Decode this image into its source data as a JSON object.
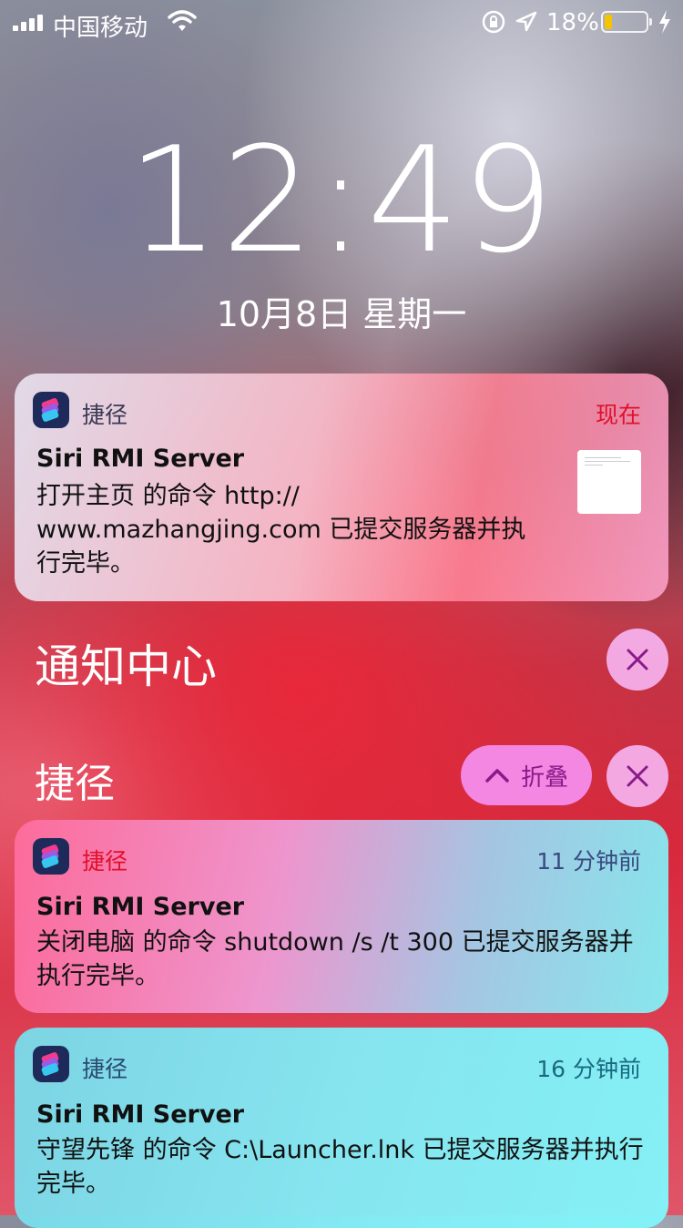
{
  "status_bar": {
    "carrier": "中国移动",
    "battery_percent_text": "18%",
    "battery_level": 0.18,
    "battery_color": "#f5c400"
  },
  "lock_screen": {
    "time": "12:49",
    "date": "10月8日 星期一"
  },
  "notifications": [
    {
      "app": "捷径",
      "time": "现在",
      "time_color": "#e0102a",
      "title": "Siri RMI Server",
      "body": "打开主页 的命令 http:// www.mazhangjing.com 已提交服务器并执行完毕。",
      "has_thumbnail": true
    }
  ],
  "notification_center": {
    "title": "通知中心",
    "close_icon": "close-icon"
  },
  "group": {
    "title": "捷径",
    "collapse_label": "折叠",
    "collapse_icon": "chevron-up-icon",
    "close_icon": "close-icon",
    "items": [
      {
        "app": "捷径",
        "app_color": "#e0102a",
        "time": "11 分钟前",
        "time_color": "#3a4a80",
        "title": "Siri RMI Server",
        "body": "关闭电脑 的命令 shutdown /s /t 300 已提交服务器并执行完毕。"
      },
      {
        "app": "捷径",
        "app_color": "#2a4a70",
        "time": "16 分钟前",
        "time_color": "#1a6a80",
        "title": "Siri RMI Server",
        "body": "守望先锋 的命令 C:\\Launcher.lnk 已提交服务器并执行完毕。"
      }
    ]
  }
}
